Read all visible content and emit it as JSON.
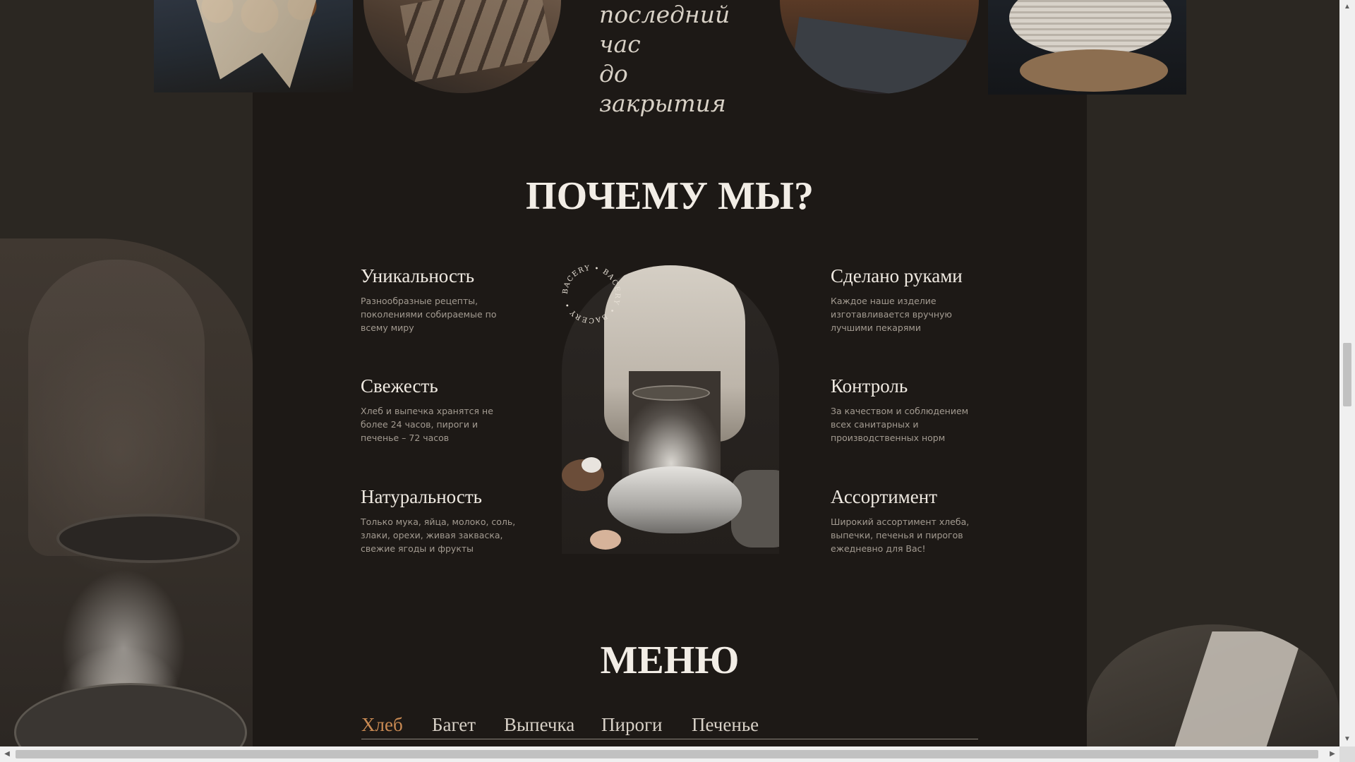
{
  "hero": {
    "close_line1": "последний час",
    "close_line2": "до закрытия"
  },
  "why": {
    "title": "ПОЧЕМУ МЫ?",
    "stamp_text": "BACERY • BACERY • BACERY •",
    "features": [
      {
        "title": "Уникальность",
        "text": "Разнообразные рецепты, поколениями собираемые по всему миру"
      },
      {
        "title": "Свежесть",
        "text": "Хлеб и выпечка  хранятся не более 24 часов, пироги и печенье – 72 часов"
      },
      {
        "title": "Натуральность",
        "text": "Только мука, яйца, молоко, соль, злаки, орехи, живая закваска, свежие ягоды и фрукты"
      },
      {
        "title": "Сделано руками",
        "text": "Каждое наше изделие изготавливается вручную лучшими пекарями"
      },
      {
        "title": "Контроль",
        "text": "За качеством и соблюдением всех санитарных  и производственных норм"
      },
      {
        "title": "Ассортимент",
        "text": "Широкий ассортимент хлеба, выпечки, печенья и пирогов ежедневно для Вас!"
      }
    ]
  },
  "menu": {
    "title": "МЕНЮ",
    "tabs": [
      "Хлеб",
      "Багет",
      "Выпечка",
      "Пироги",
      "Печенье"
    ],
    "active_tab": "Хлеб"
  },
  "colors": {
    "background": "#2b2722",
    "column": "#1d1916",
    "accent": "#c98a53",
    "text_primary": "#f2ede6",
    "text_secondary": "#a39b91"
  },
  "scrollbar": {
    "up_icon": "▲",
    "down_icon": "▼",
    "left_icon": "◀",
    "right_icon": "▶"
  }
}
